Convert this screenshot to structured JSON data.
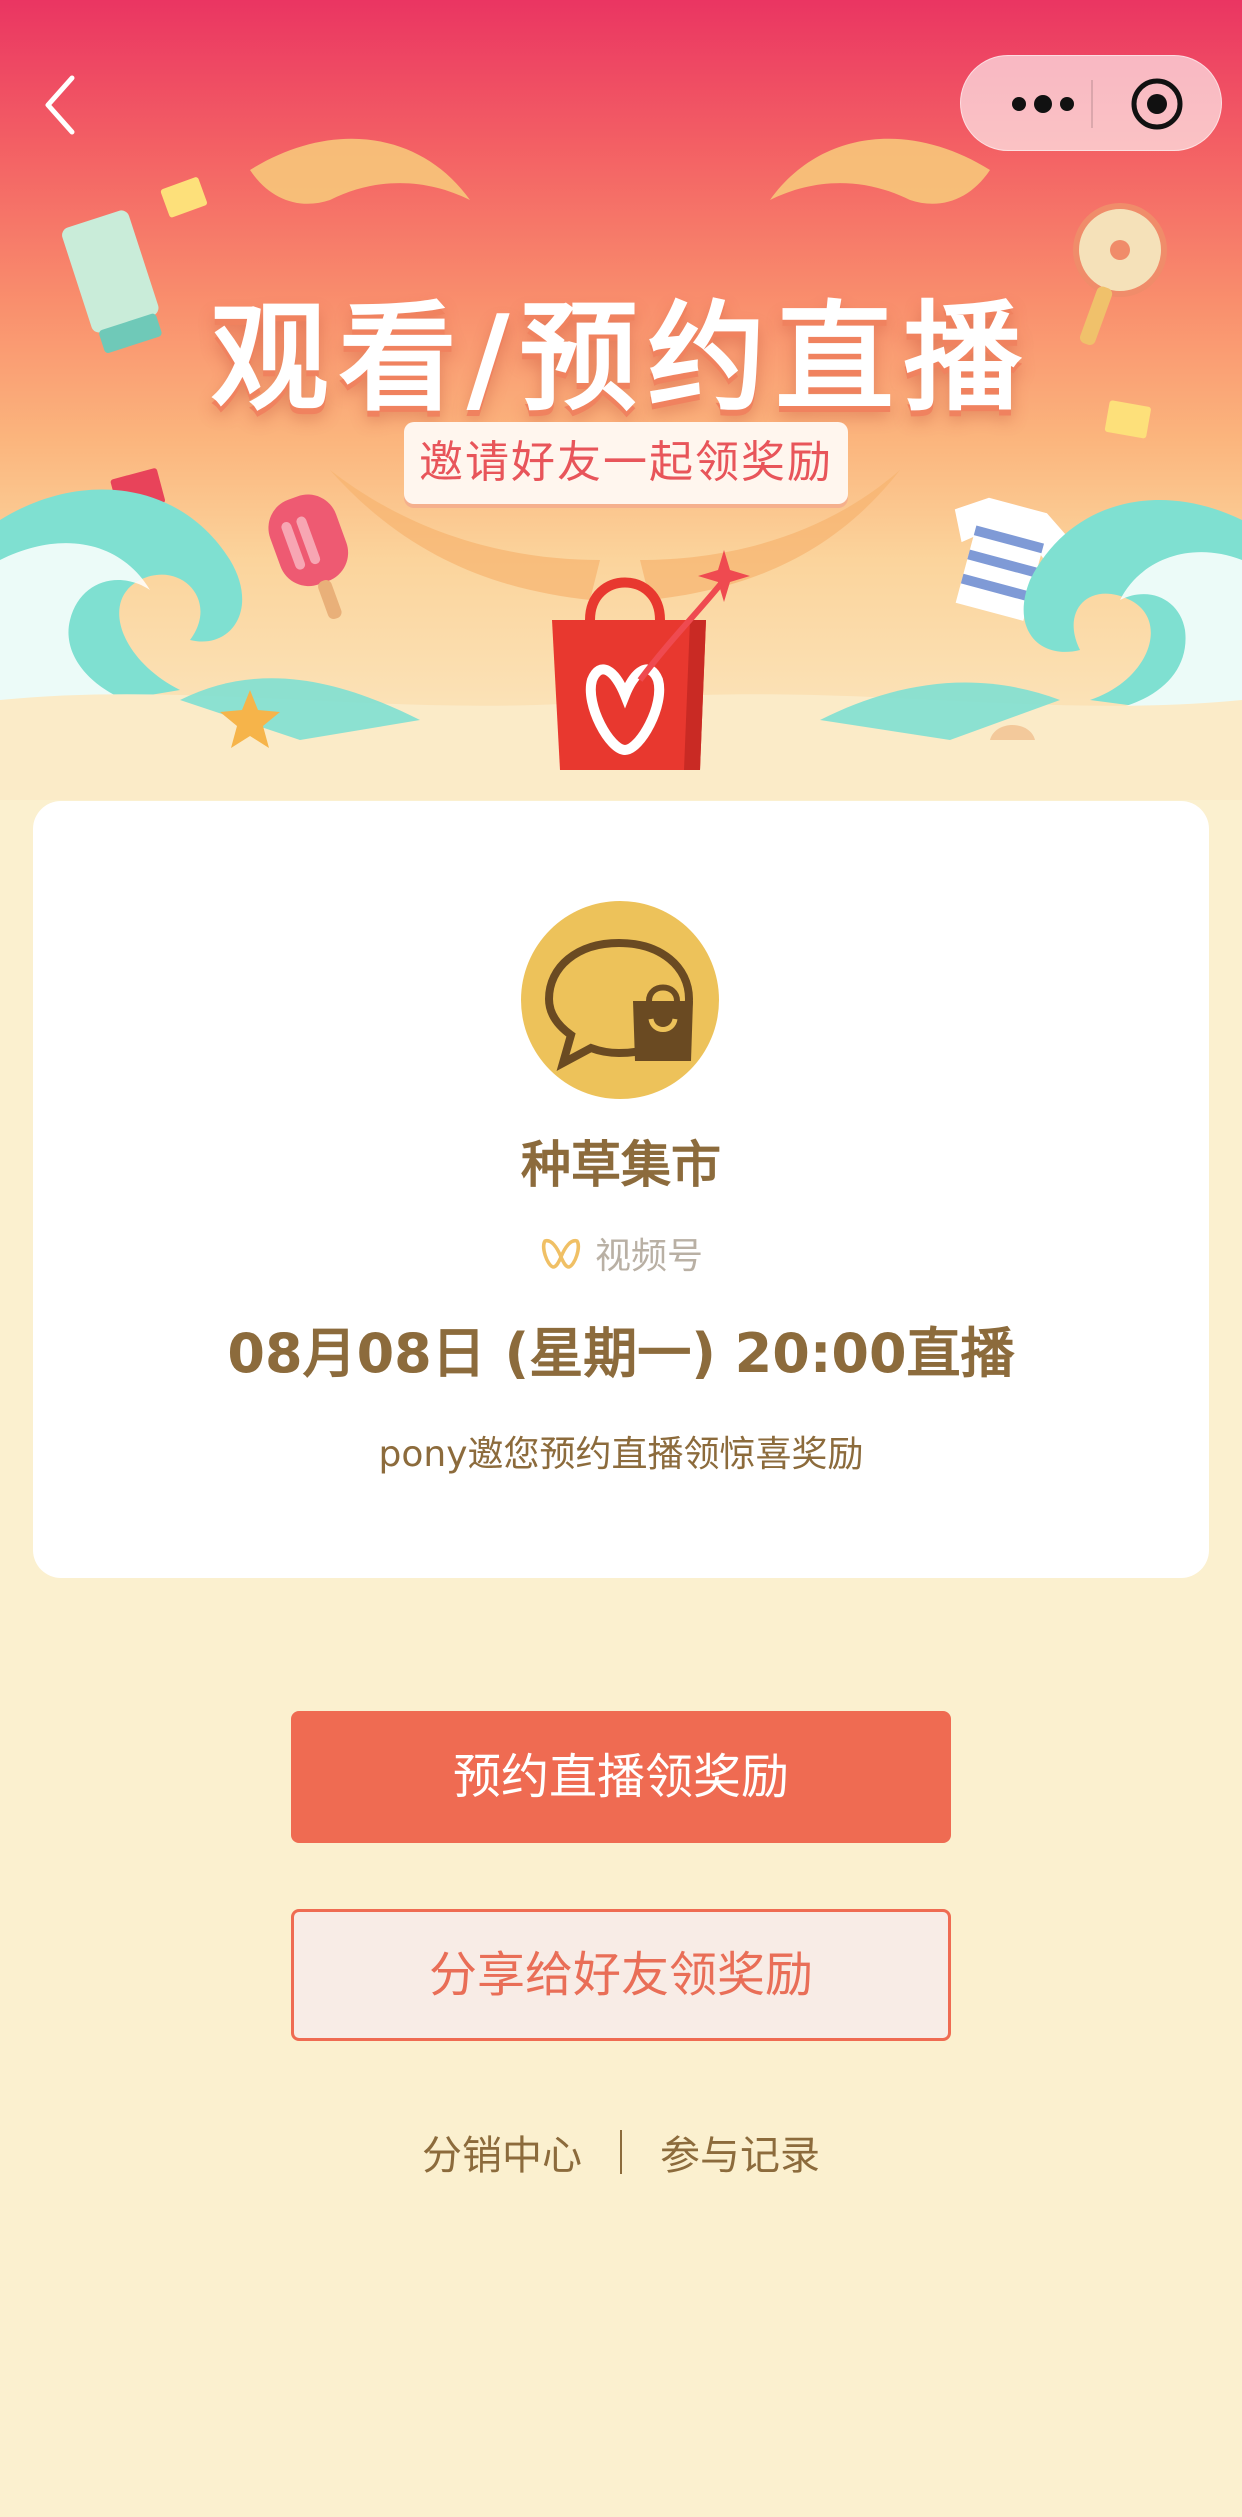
{
  "banner": {
    "title": "观看/预约直播",
    "subtitle": "邀请好友一起领奖励"
  },
  "nav": {
    "back_icon": "chevron-left-icon",
    "more_icon": "more-dots-icon",
    "close_icon": "mini-program-close-icon"
  },
  "card": {
    "shop_name": "种草集市",
    "channel_label": "视频号",
    "live_time": "08月08日 (星期一) 20:00直播",
    "invite_text": "pony邀您预约直播领惊喜奖励"
  },
  "buttons": {
    "primary_label": "预约直播领奖励",
    "secondary_label": "分享给好友领奖励"
  },
  "footer": {
    "left_link": "分销中心",
    "right_link": "参与记录"
  },
  "colors": {
    "background": "#fbf0cf",
    "primary": "#ef6b52",
    "text_brown": "#8c6b3c",
    "avatar_yellow": "#edc25a"
  }
}
